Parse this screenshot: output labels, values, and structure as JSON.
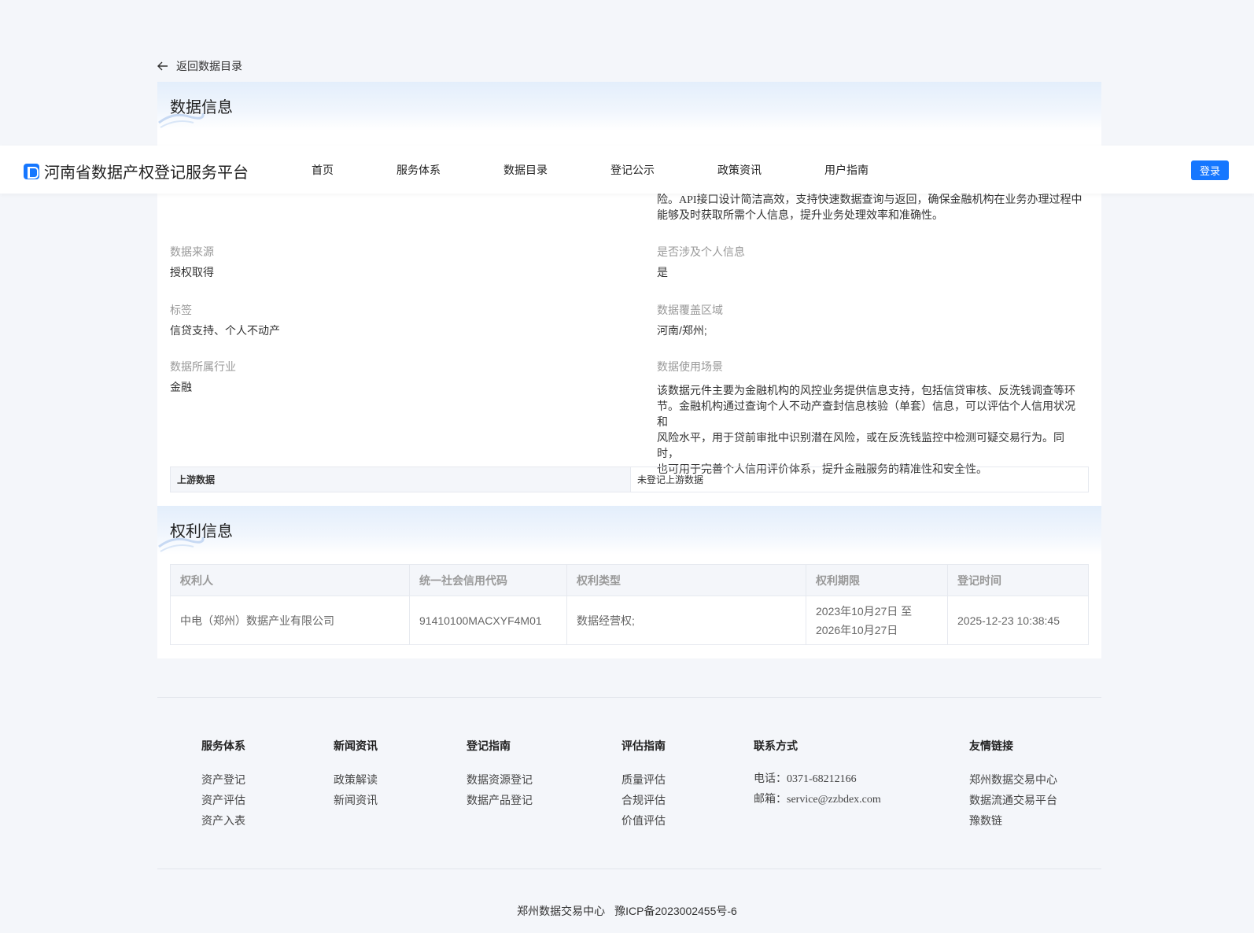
{
  "back": {
    "label": "返回数据目录"
  },
  "data_section": {
    "title": "数据信息",
    "description_lines": [
      "险。API接口设计简洁高效，支持快速数据查询与返回，确保金融机构在业务办理过程中",
      "能够及时获取所需个人信息，提升业务处理效率和准确性。"
    ],
    "fields": {
      "source": {
        "label": "数据来源",
        "value": "授权取得"
      },
      "personal": {
        "label": "是否涉及个人信息",
        "value": "是"
      },
      "tags": {
        "label": "标签",
        "value": "信贷支持、个人不动产"
      },
      "coverage": {
        "label": "数据覆盖区域",
        "value": "河南/郑州;"
      },
      "industry": {
        "label": "数据所属行业",
        "value": "金融"
      },
      "scene": {
        "label": "数据使用场景"
      }
    },
    "scene_lines": [
      "该数据元件主要为金融机构的风控业务提供信息支持，包括信贷审核、反洗钱调查等环",
      "节。金融机构通过查询个人不动产查封信息核验（单套）信息，可以评估个人信用状况和",
      "风险水平，用于贷前审批中识别潜在风险，或在反洗钱监控中检测可疑交易行为。同时，",
      "也可用于完善个人信用评价体系，提升金融服务的精准性和安全性。"
    ],
    "upstream": {
      "label": "上游数据",
      "value": "未登记上游数据"
    }
  },
  "rights_section": {
    "title": "权利信息",
    "columns": [
      "权利人",
      "统一社会信用代码",
      "权利类型",
      "权利期限",
      "登记时间"
    ],
    "row": {
      "holder": "中电（郑州）数据产业有限公司",
      "code": "91410100MACXYF4M01",
      "type": "数据经营权;",
      "term_line1": "2023年10月27日 至",
      "term_line2": "2026年10月27日",
      "time": "2025-12-23 10:38:45"
    }
  },
  "topbar": {
    "brand": "河南省数据产权登记服务平台",
    "nav": [
      "首页",
      "服务体系",
      "数据目录",
      "登记公示",
      "政策资讯",
      "用户指南"
    ],
    "login": "登录",
    "accent": "#1677ff"
  },
  "footer": {
    "cols": [
      {
        "title": "服务体系",
        "links": [
          "资产登记",
          "资产评估",
          "资产入表"
        ]
      },
      {
        "title": "新闻资讯",
        "links": [
          "政策解读",
          "新闻资讯"
        ]
      },
      {
        "title": "登记指南",
        "links": [
          "数据资源登记",
          "数据产品登记"
        ]
      },
      {
        "title": "评估指南",
        "links": [
          "质量评估",
          "合规评估",
          "价值评估"
        ]
      },
      {
        "title": "联系方式",
        "links": [
          "电话：0371-68212166",
          "邮箱：service@zzbdex.com"
        ]
      },
      {
        "title": "友情链接",
        "links": [
          "郑州数据交易中心",
          "数据流通交易平台",
          "豫数链"
        ]
      }
    ],
    "org": "郑州数据交易中心",
    "icp": "豫ICP备2023002455号-6"
  }
}
